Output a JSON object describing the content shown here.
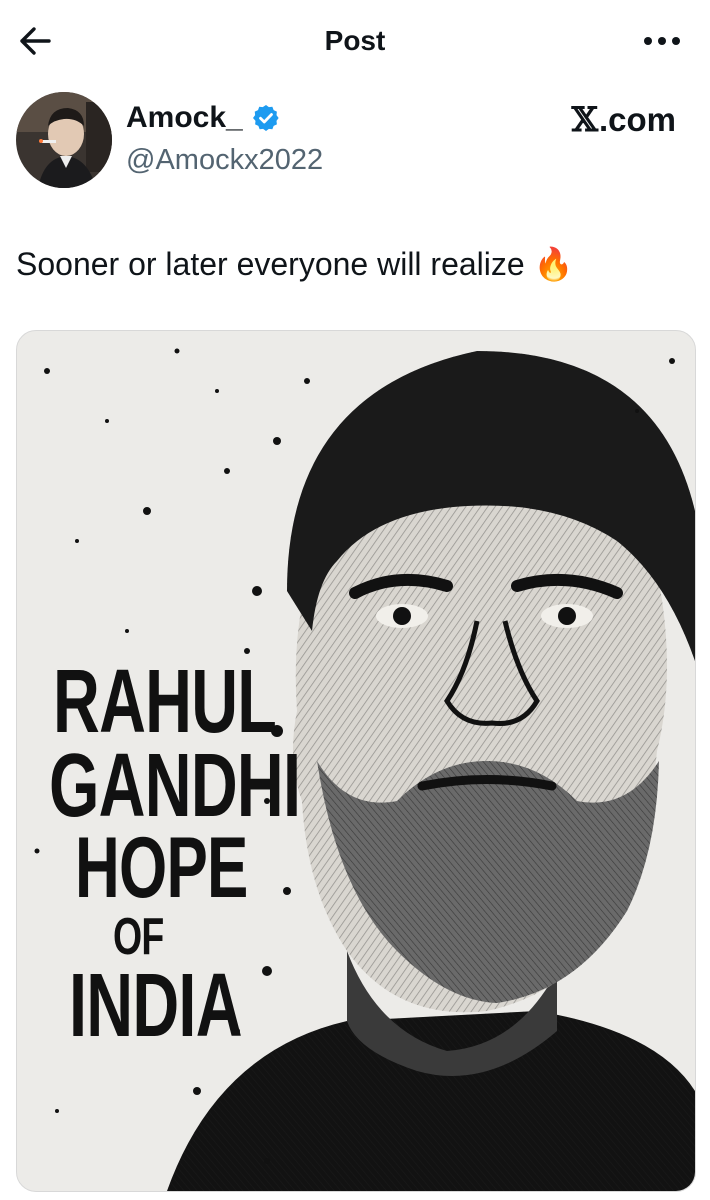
{
  "header": {
    "title": "Post"
  },
  "author": {
    "display_name": "Amock_",
    "handle": "@Amockx2022",
    "verified_icon": "verified-badge-icon",
    "verified_color": "#1d9bf0"
  },
  "brand": {
    "x_mark": "𝕏",
    "suffix": ".com"
  },
  "tweet": {
    "text": "Sooner or later everyone will realize 🔥"
  },
  "media": {
    "poster_lines": [
      "RAHUL",
      "GANDHI",
      "HOPE",
      "OF",
      "INDIA"
    ]
  },
  "colors": {
    "secondary_text": "#536471",
    "primary_text": "#0f1419"
  }
}
